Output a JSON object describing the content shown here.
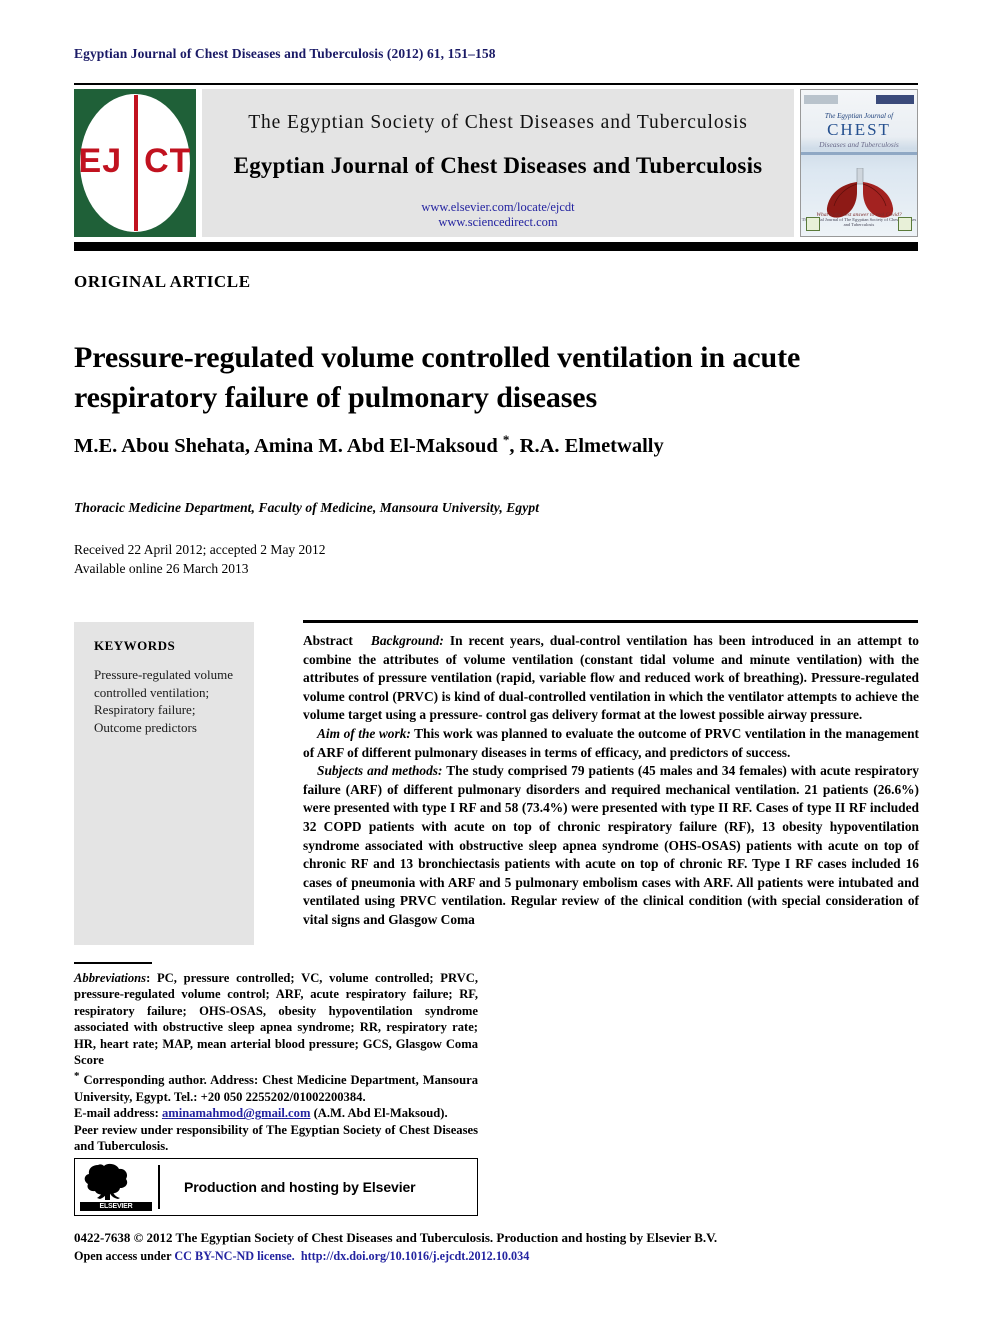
{
  "running_head": "Egyptian Journal of Chest Diseases and Tuberculosis (2012) 61, 151–158",
  "masthead": {
    "logo_left": "EJ",
    "logo_right": "CT",
    "society_line": "The Egyptian Society of Chest Diseases and Tuberculosis",
    "journal_line": "Egyptian Journal of Chest Diseases and Tuberculosis",
    "url_elsevier": "www.elsevier.com/locate/ejcdt",
    "url_sciencedirect": "www.sciencedirect.com",
    "cover": {
      "line1": "The Egyptian Journal of",
      "line2": "CHEST",
      "line3": "Diseases and Tuberculosis",
      "foot1": "What is the best answer to real Covid?",
      "foot2": "The Official Journal of The Egyptian Society of Chest Diseases and Tuberculosis"
    }
  },
  "article_type": "ORIGINAL ARTICLE",
  "title": "Pressure-regulated volume controlled ventilation in acute respiratory failure of pulmonary diseases",
  "authors": {
    "pre": "M.E. Abou Shehata, Amina M. Abd El-Maksoud ",
    "marker": "*",
    "post": ", R.A. Elmetwally"
  },
  "affiliation": "Thoracic Medicine Department, Faculty of Medicine, Mansoura University, Egypt",
  "dates": {
    "received": "Received 22 April 2012; accepted 2 May 2012",
    "online": "Available online 26 March 2013"
  },
  "keywords": {
    "heading": "KEYWORDS",
    "items": "Pressure-regulated volume controlled ventilation; Respiratory failure; Outcome predictors"
  },
  "abstract": {
    "label": "Abstract",
    "background_label": "Background:",
    "background_text": " In recent years, dual-control ventilation has been introduced in an attempt to combine the attributes of volume ventilation (constant tidal volume and minute ventilation) with the attributes of pressure ventilation (rapid, variable flow and reduced work of breathing). Pressure-regulated volume control (PRVC) is kind of dual-controlled ventilation in which the ventilator attempts to achieve the volume target using a pressure- control gas delivery format at the lowest possible airway pressure.",
    "aim_label": "Aim of the work:",
    "aim_text": " This work was planned to evaluate the outcome of PRVC ventilation in the management of ARF of different pulmonary diseases in terms of efficacy, and predictors of success.",
    "methods_label": "Subjects and methods:",
    "methods_text": " The study comprised 79 patients (45 males and 34 females) with acute respiratory failure (ARF) of different pulmonary disorders and required mechanical ventilation. 21 patients (26.6%) were presented with type I RF and 58 (73.4%) were presented with type II RF. Cases of type II RF included 32 COPD patients with acute on top of chronic respiratory failure (RF), 13 obesity hypoventilation syndrome associated with obstructive sleep apnea syndrome (OHS-OSAS) patients with acute on top of chronic RF and 13 bronchiectasis patients with acute on top of chronic RF. Type I RF cases included 16 cases of pneumonia with ARF and 5 pulmonary embolism cases with ARF. All patients were intubated and ventilated using PRVC ventilation. Regular review of the clinical condition (with special consideration of vital signs and Glasgow Coma"
  },
  "footnotes": {
    "abbrev_label": "Abbreviations",
    "abbrev_text": ": PC, pressure controlled; VC, volume controlled; PRVC, pressure-regulated volume control; ARF, acute respiratory failure; RF, respiratory failure; OHS-OSAS, obesity hypoventilation syndrome associated with obstructive sleep apnea syndrome; RR, respiratory rate; HR, heart rate; MAP, mean arterial blood pressure; GCS, Glasgow Coma Score",
    "corresponding_marker": "*",
    "corresponding_text": " Corresponding author. Address: Chest Medicine Department, Mansoura University, Egypt. Tel.: +20 050 2255202/01002200384.",
    "email_label": "E-mail address: ",
    "email": "aminamahmod@gmail.com",
    "email_suffix": " (A.M. Abd El-Maksoud).",
    "peer_review": "Peer review under responsibility of The Egyptian Society of Chest Diseases and Tuberculosis."
  },
  "production_box": {
    "logo_label": "ELSEVIER",
    "text": "Production and hosting by Elsevier"
  },
  "copyright": {
    "line1": "0422-7638 © 2012 The Egyptian Society of Chest Diseases and Tuberculosis. Production and hosting by Elsevier B.V.",
    "open_access": "Open access under ",
    "license": "CC BY-NC-ND license.",
    "doi": "http://dx.doi.org/10.1016/j.ejcdt.2012.10.034"
  },
  "colors": {
    "logo_green": "#1f6038",
    "logo_red": "#c1121f",
    "link_blue": "#2323a0",
    "panel_gray": "#e4e4e4"
  }
}
